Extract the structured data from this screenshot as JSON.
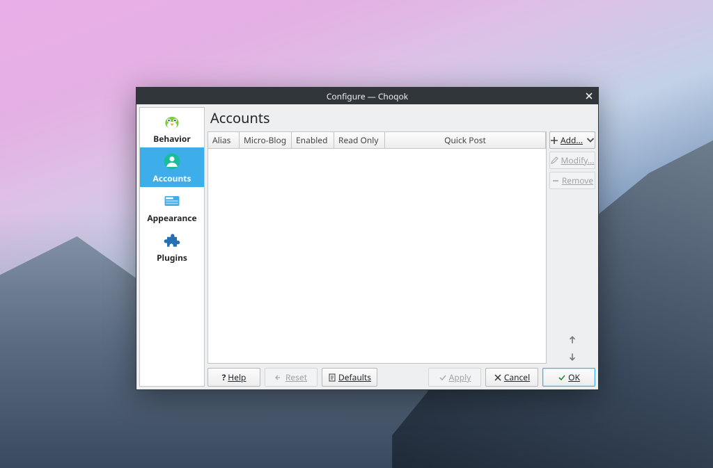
{
  "window": {
    "title": "Configure — Choqok"
  },
  "sidebar": {
    "items": [
      {
        "label": "Behavior"
      },
      {
        "label": "Accounts"
      },
      {
        "label": "Appearance"
      },
      {
        "label": "Plugins"
      }
    ],
    "selected_index": 1
  },
  "page": {
    "title": "Accounts"
  },
  "table": {
    "columns": {
      "alias": "Alias",
      "microblog": "Micro-Blog",
      "enabled": "Enabled",
      "readonly": "Read Only",
      "quickpost": "Quick Post"
    },
    "rows": []
  },
  "side_buttons": {
    "add": "Add...",
    "modify": "Modify...",
    "remove": "Remove"
  },
  "footer": {
    "help": "Help",
    "reset": "Reset",
    "defaults": "Defaults",
    "apply": "Apply",
    "cancel": "Cancel",
    "ok": "OK"
  }
}
